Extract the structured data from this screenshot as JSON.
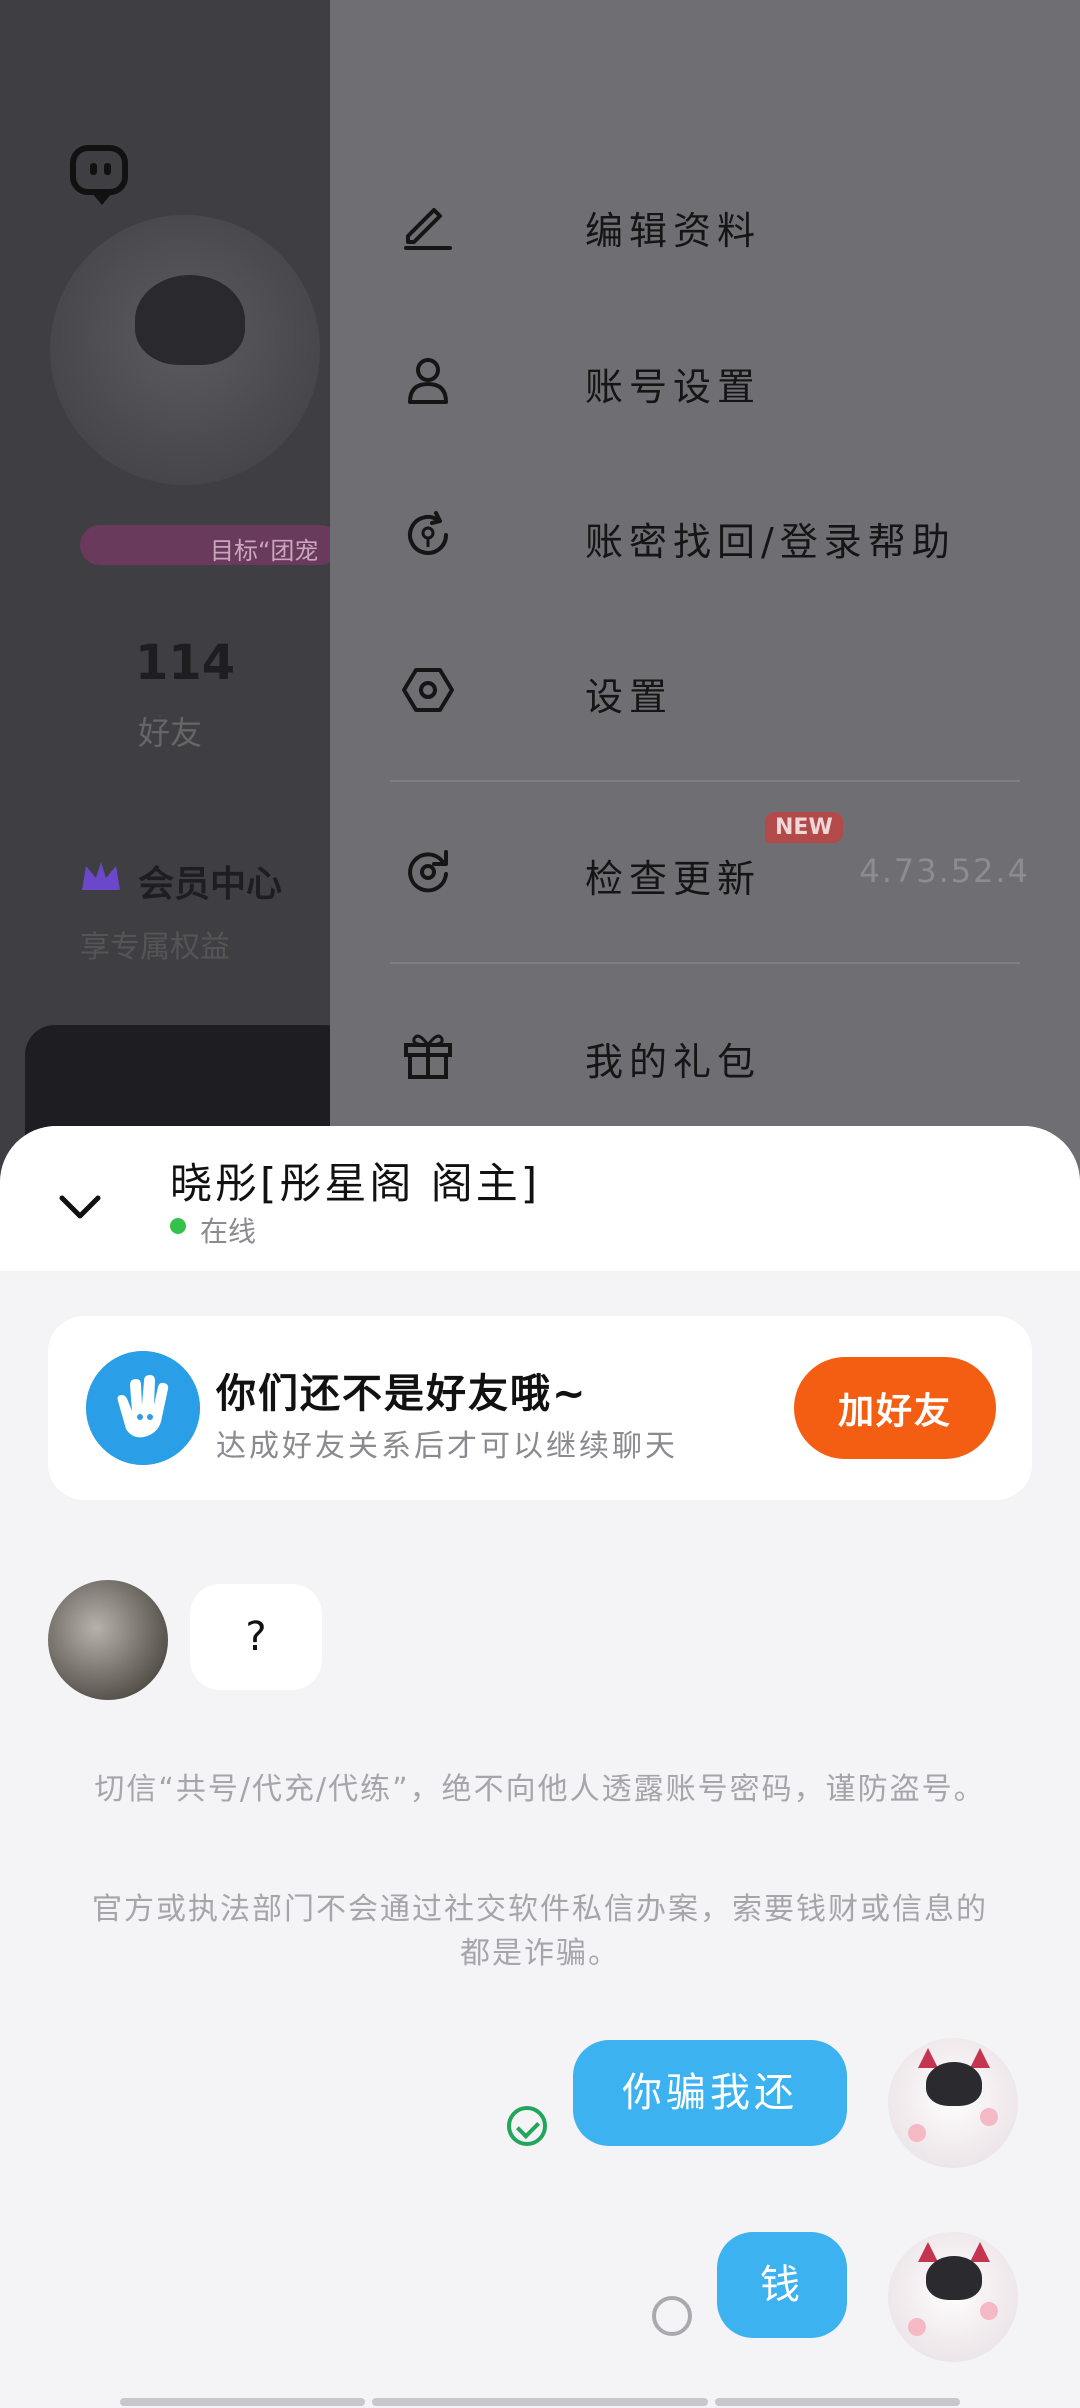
{
  "profile_page": {
    "friend_count": "114",
    "friend_label": "好友",
    "badge_text": "目标“团宠",
    "vip_title": "会员中心",
    "vip_subtitle": "享专属权益"
  },
  "drawer_menu": {
    "items": [
      {
        "icon": "pencil-icon",
        "label": "编辑资料"
      },
      {
        "icon": "user-icon",
        "label": "账号设置"
      },
      {
        "icon": "account-recovery-icon",
        "label": "账密找回/登录帮助"
      },
      {
        "icon": "settings-hexagon-icon",
        "label": "设置"
      },
      {
        "icon": "update-icon",
        "label": "检查更新",
        "badge": "NEW",
        "value": "4.73.52.4"
      },
      {
        "icon": "gift-icon",
        "label": "我的礼包"
      }
    ]
  },
  "chat": {
    "contact_name": "晓彤[彤星阁 阁主]",
    "status": "在线",
    "friend_card": {
      "title": "你们还不是好友哦~",
      "subtitle": "达成好友关系后才可以继续聊天",
      "button": "加好友"
    },
    "incoming_message": "?",
    "notices": [
      "切信“共号/代充/代练”，绝不向他人透露账号密码，谨防盗号。",
      "官方或执法部门不会通过社交软件私信办案，索要钱财或信息的都是诈骗。"
    ],
    "outgoing_messages": [
      {
        "text": "你骗我还",
        "status": "read"
      },
      {
        "text": "钱",
        "status": "pending"
      }
    ]
  },
  "colors": {
    "accent_orange": "#f45e12",
    "bubble_blue": "#3cb3f0",
    "online_green": "#34c24a",
    "hand_icon_blue": "#2a9ee6"
  }
}
